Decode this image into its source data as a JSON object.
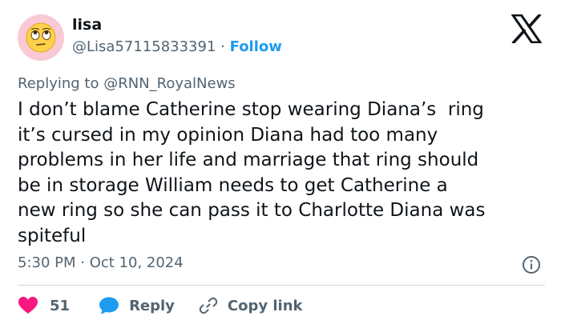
{
  "user": {
    "name": "lisa",
    "handle": "@Lisa57115833391",
    "separator": "·",
    "follow_label": "Follow",
    "avatar_icon": "eye-roll-emoji-icon"
  },
  "logo_icon": "x-logo-icon",
  "reply_prefix": "Replying to ",
  "reply_handle": "@RNN_RoyalNews",
  "tweet_text": "I don’t blame Catherine stop wearing Diana’s  ring\nit’s cursed in my opinion Diana had too many\nproblems in her life and marriage that ring should\nbe in storage William needs to get Catherine a\nnew ring so she can pass it to Charlotte Diana was\nspiteful",
  "timestamp": "5:30 PM · Oct 10, 2024",
  "actions": {
    "like_count": "51",
    "reply_label": "Reply",
    "copy_label": "Copy link"
  },
  "colors": {
    "accent": "#1d9bf0",
    "like": "#f91880",
    "muted": "#536471",
    "text": "#0f1419"
  }
}
